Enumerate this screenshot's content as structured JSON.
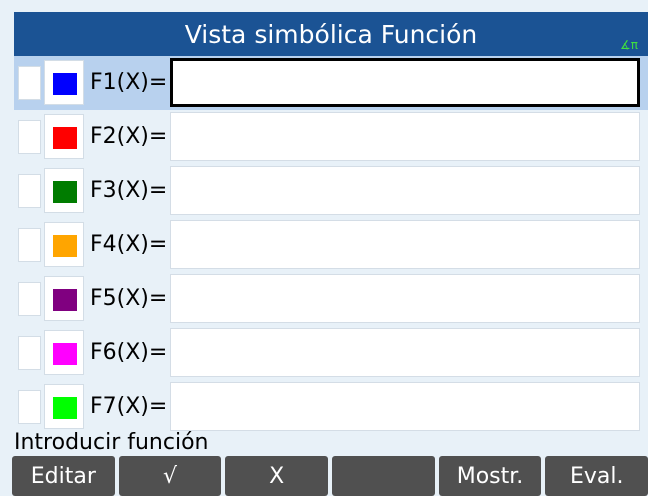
{
  "header": {
    "title": "Vista simbólica Función",
    "angle_mode": "∡π"
  },
  "functions": [
    {
      "label": "F1(X)=",
      "color": "#0000ff",
      "value": "",
      "selected": true
    },
    {
      "label": "F2(X)=",
      "color": "#ff0000",
      "value": "",
      "selected": false
    },
    {
      "label": "F3(X)=",
      "color": "#007c00",
      "value": "",
      "selected": false
    },
    {
      "label": "F4(X)=",
      "color": "#ffa500",
      "value": "",
      "selected": false
    },
    {
      "label": "F5(X)=",
      "color": "#800080",
      "value": "",
      "selected": false
    },
    {
      "label": "F6(X)=",
      "color": "#ff00ff",
      "value": "",
      "selected": false
    },
    {
      "label": "F7(X)=",
      "color": "#00ff00",
      "value": "",
      "selected": false
    }
  ],
  "status": {
    "text": "Introducir función"
  },
  "menu": {
    "items": [
      "Editar",
      "√",
      "X",
      "",
      "Mostr.",
      "Eval."
    ]
  }
}
